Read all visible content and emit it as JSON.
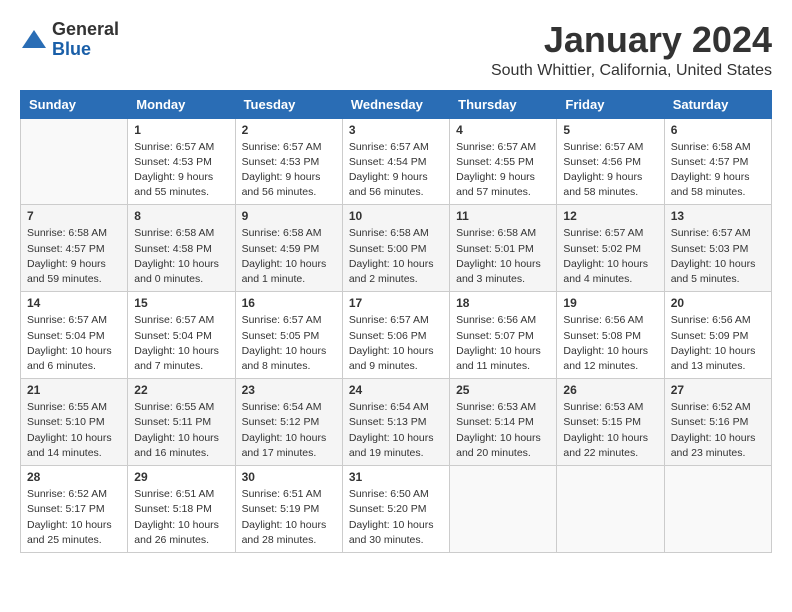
{
  "header": {
    "logo_line1": "General",
    "logo_line2": "Blue",
    "title": "January 2024",
    "subtitle": "South Whittier, California, United States"
  },
  "columns": [
    "Sunday",
    "Monday",
    "Tuesday",
    "Wednesday",
    "Thursday",
    "Friday",
    "Saturday"
  ],
  "weeks": [
    [
      {
        "day": "",
        "info": ""
      },
      {
        "day": "1",
        "info": "Sunrise: 6:57 AM\nSunset: 4:53 PM\nDaylight: 9 hours\nand 55 minutes."
      },
      {
        "day": "2",
        "info": "Sunrise: 6:57 AM\nSunset: 4:53 PM\nDaylight: 9 hours\nand 56 minutes."
      },
      {
        "day": "3",
        "info": "Sunrise: 6:57 AM\nSunset: 4:54 PM\nDaylight: 9 hours\nand 56 minutes."
      },
      {
        "day": "4",
        "info": "Sunrise: 6:57 AM\nSunset: 4:55 PM\nDaylight: 9 hours\nand 57 minutes."
      },
      {
        "day": "5",
        "info": "Sunrise: 6:57 AM\nSunset: 4:56 PM\nDaylight: 9 hours\nand 58 minutes."
      },
      {
        "day": "6",
        "info": "Sunrise: 6:58 AM\nSunset: 4:57 PM\nDaylight: 9 hours\nand 58 minutes."
      }
    ],
    [
      {
        "day": "7",
        "info": "Sunrise: 6:58 AM\nSunset: 4:57 PM\nDaylight: 9 hours\nand 59 minutes."
      },
      {
        "day": "8",
        "info": "Sunrise: 6:58 AM\nSunset: 4:58 PM\nDaylight: 10 hours\nand 0 minutes."
      },
      {
        "day": "9",
        "info": "Sunrise: 6:58 AM\nSunset: 4:59 PM\nDaylight: 10 hours\nand 1 minute."
      },
      {
        "day": "10",
        "info": "Sunrise: 6:58 AM\nSunset: 5:00 PM\nDaylight: 10 hours\nand 2 minutes."
      },
      {
        "day": "11",
        "info": "Sunrise: 6:58 AM\nSunset: 5:01 PM\nDaylight: 10 hours\nand 3 minutes."
      },
      {
        "day": "12",
        "info": "Sunrise: 6:57 AM\nSunset: 5:02 PM\nDaylight: 10 hours\nand 4 minutes."
      },
      {
        "day": "13",
        "info": "Sunrise: 6:57 AM\nSunset: 5:03 PM\nDaylight: 10 hours\nand 5 minutes."
      }
    ],
    [
      {
        "day": "14",
        "info": "Sunrise: 6:57 AM\nSunset: 5:04 PM\nDaylight: 10 hours\nand 6 minutes."
      },
      {
        "day": "15",
        "info": "Sunrise: 6:57 AM\nSunset: 5:04 PM\nDaylight: 10 hours\nand 7 minutes."
      },
      {
        "day": "16",
        "info": "Sunrise: 6:57 AM\nSunset: 5:05 PM\nDaylight: 10 hours\nand 8 minutes."
      },
      {
        "day": "17",
        "info": "Sunrise: 6:57 AM\nSunset: 5:06 PM\nDaylight: 10 hours\nand 9 minutes."
      },
      {
        "day": "18",
        "info": "Sunrise: 6:56 AM\nSunset: 5:07 PM\nDaylight: 10 hours\nand 11 minutes."
      },
      {
        "day": "19",
        "info": "Sunrise: 6:56 AM\nSunset: 5:08 PM\nDaylight: 10 hours\nand 12 minutes."
      },
      {
        "day": "20",
        "info": "Sunrise: 6:56 AM\nSunset: 5:09 PM\nDaylight: 10 hours\nand 13 minutes."
      }
    ],
    [
      {
        "day": "21",
        "info": "Sunrise: 6:55 AM\nSunset: 5:10 PM\nDaylight: 10 hours\nand 14 minutes."
      },
      {
        "day": "22",
        "info": "Sunrise: 6:55 AM\nSunset: 5:11 PM\nDaylight: 10 hours\nand 16 minutes."
      },
      {
        "day": "23",
        "info": "Sunrise: 6:54 AM\nSunset: 5:12 PM\nDaylight: 10 hours\nand 17 minutes."
      },
      {
        "day": "24",
        "info": "Sunrise: 6:54 AM\nSunset: 5:13 PM\nDaylight: 10 hours\nand 19 minutes."
      },
      {
        "day": "25",
        "info": "Sunrise: 6:53 AM\nSunset: 5:14 PM\nDaylight: 10 hours\nand 20 minutes."
      },
      {
        "day": "26",
        "info": "Sunrise: 6:53 AM\nSunset: 5:15 PM\nDaylight: 10 hours\nand 22 minutes."
      },
      {
        "day": "27",
        "info": "Sunrise: 6:52 AM\nSunset: 5:16 PM\nDaylight: 10 hours\nand 23 minutes."
      }
    ],
    [
      {
        "day": "28",
        "info": "Sunrise: 6:52 AM\nSunset: 5:17 PM\nDaylight: 10 hours\nand 25 minutes."
      },
      {
        "day": "29",
        "info": "Sunrise: 6:51 AM\nSunset: 5:18 PM\nDaylight: 10 hours\nand 26 minutes."
      },
      {
        "day": "30",
        "info": "Sunrise: 6:51 AM\nSunset: 5:19 PM\nDaylight: 10 hours\nand 28 minutes."
      },
      {
        "day": "31",
        "info": "Sunrise: 6:50 AM\nSunset: 5:20 PM\nDaylight: 10 hours\nand 30 minutes."
      },
      {
        "day": "",
        "info": ""
      },
      {
        "day": "",
        "info": ""
      },
      {
        "day": "",
        "info": ""
      }
    ]
  ]
}
